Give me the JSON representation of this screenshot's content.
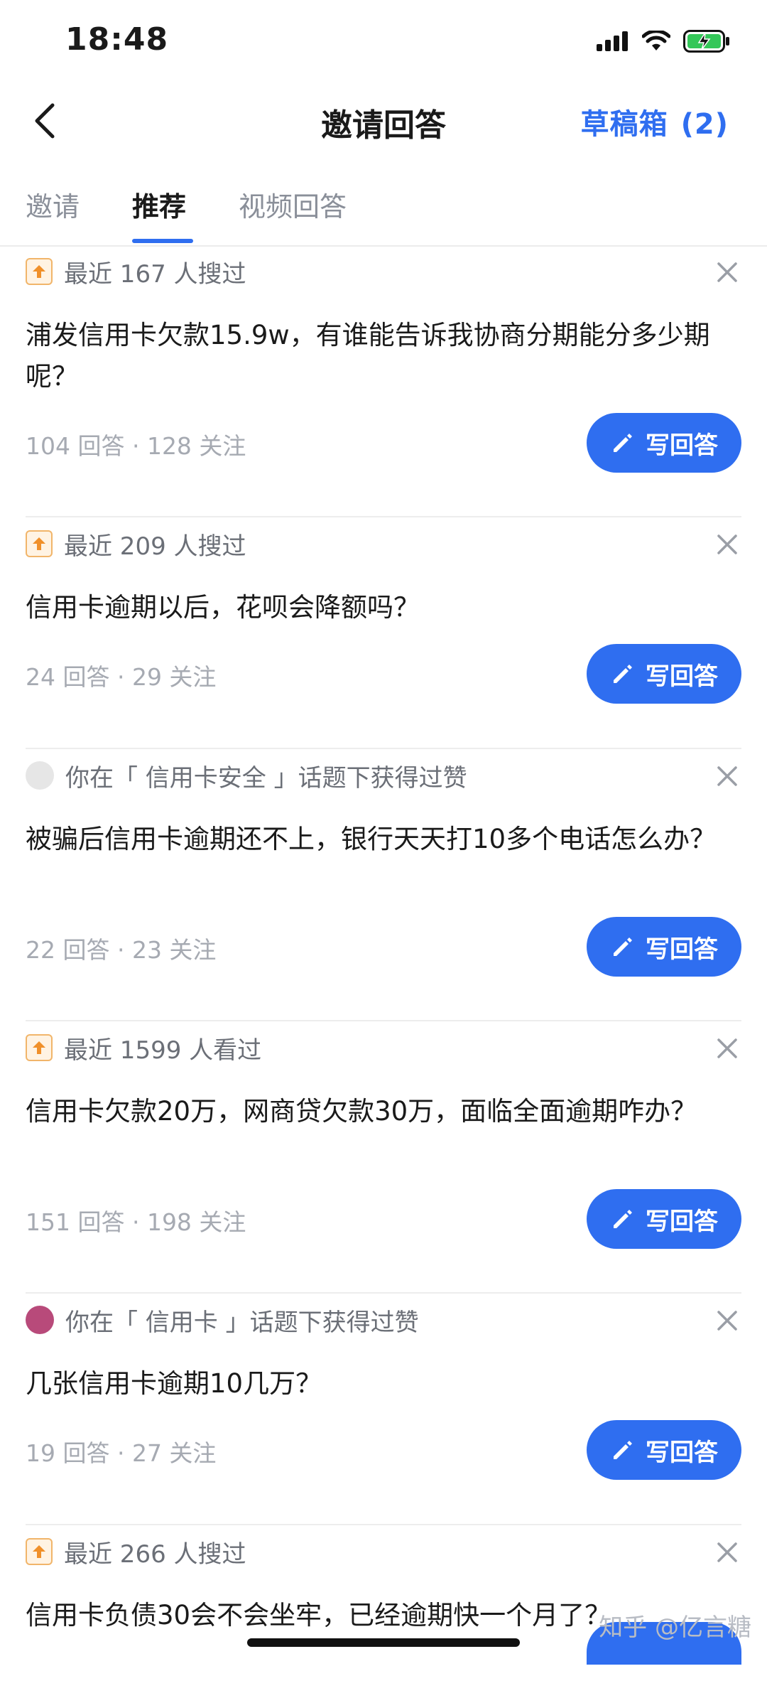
{
  "status_bar": {
    "time": "18:48"
  },
  "nav": {
    "title": "邀请回答",
    "drafts_label": "草稿箱",
    "drafts_count": "(2)"
  },
  "tabs": [
    "邀请",
    "推荐",
    "视频回答"
  ],
  "button_label": "写回答",
  "items": [
    {
      "meta": "最近 167 人搜过",
      "title": "浦发信用卡欠款15.9w，有谁能告诉我协商分期能分多少期呢？",
      "stats": "104 回答 · 128 关注"
    },
    {
      "meta": "最近 209 人搜过",
      "title": "信用卡逾期以后，花呗会降额吗？",
      "stats": "24 回答 · 29 关注"
    },
    {
      "meta": "你在「 信用卡安全 」话题下获得过赞",
      "title": "被骗后信用卡逾期还不上，银行天天打10多个电话怎么办？",
      "stats": "22 回答 · 23 关注"
    },
    {
      "meta": "最近 1599 人看过",
      "title": "信用卡欠款20万，网商贷欠款30万，面临全面逾期咋办？",
      "stats": "151 回答 · 198 关注"
    },
    {
      "meta": "你在「 信用卡 」话题下获得过赞",
      "title": "几张信用卡逾期10几万？",
      "stats": "19 回答 · 27 关注"
    },
    {
      "meta": "最近 266 人搜过",
      "title": "信用卡负债30会不会坐牢，已经逾期快一个月了？"
    }
  ],
  "watermark": "知乎 @亿言糖",
  "colors": {
    "accent": "#2f6ef0",
    "muted": "#a6aab2"
  }
}
